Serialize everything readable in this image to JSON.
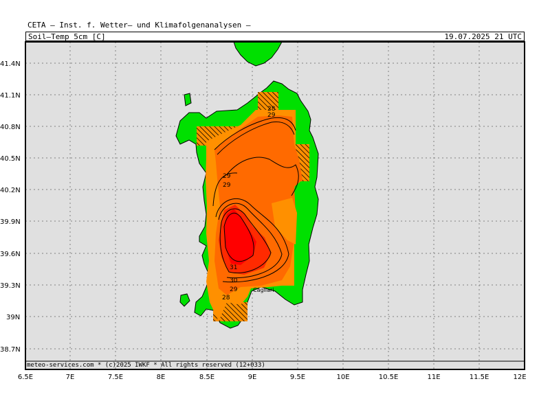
{
  "header": {
    "institution": "CETA — Inst. f. Wetter— und Klimafolgenanalysen —",
    "variable": "Soil—Temp_5cm [C]",
    "timestamp": "19.07.2025 21 UTC"
  },
  "footer": {
    "credit": "meteo-services.com * (c)2025 IWKF * All rights reserved (12+033)"
  },
  "axes": {
    "x_ticks": [
      "6.5E",
      "7E",
      "7.5E",
      "8E",
      "8.5E",
      "9E",
      "9.5E",
      "10E",
      "10.5E",
      "11E",
      "11.5E",
      "12E"
    ],
    "y_ticks": [
      "41.4N",
      "41.1N",
      "40.8N",
      "40.5N",
      "40.2N",
      "39.9N",
      "39.6N",
      "39.3N",
      "39N",
      "38.7N"
    ]
  },
  "contour_labels": [
    "28",
    "29",
    "29",
    "29",
    "31",
    "30",
    "29",
    "28"
  ],
  "place_labels": [
    "Cagliari"
  ],
  "colors": {
    "background": "#e0e0e0",
    "land": "#00e000",
    "t28": "#ff9000",
    "t29": "#ff6a00",
    "t30": "#ff2a00",
    "t31": "#ff0000",
    "contour": "#000000"
  }
}
